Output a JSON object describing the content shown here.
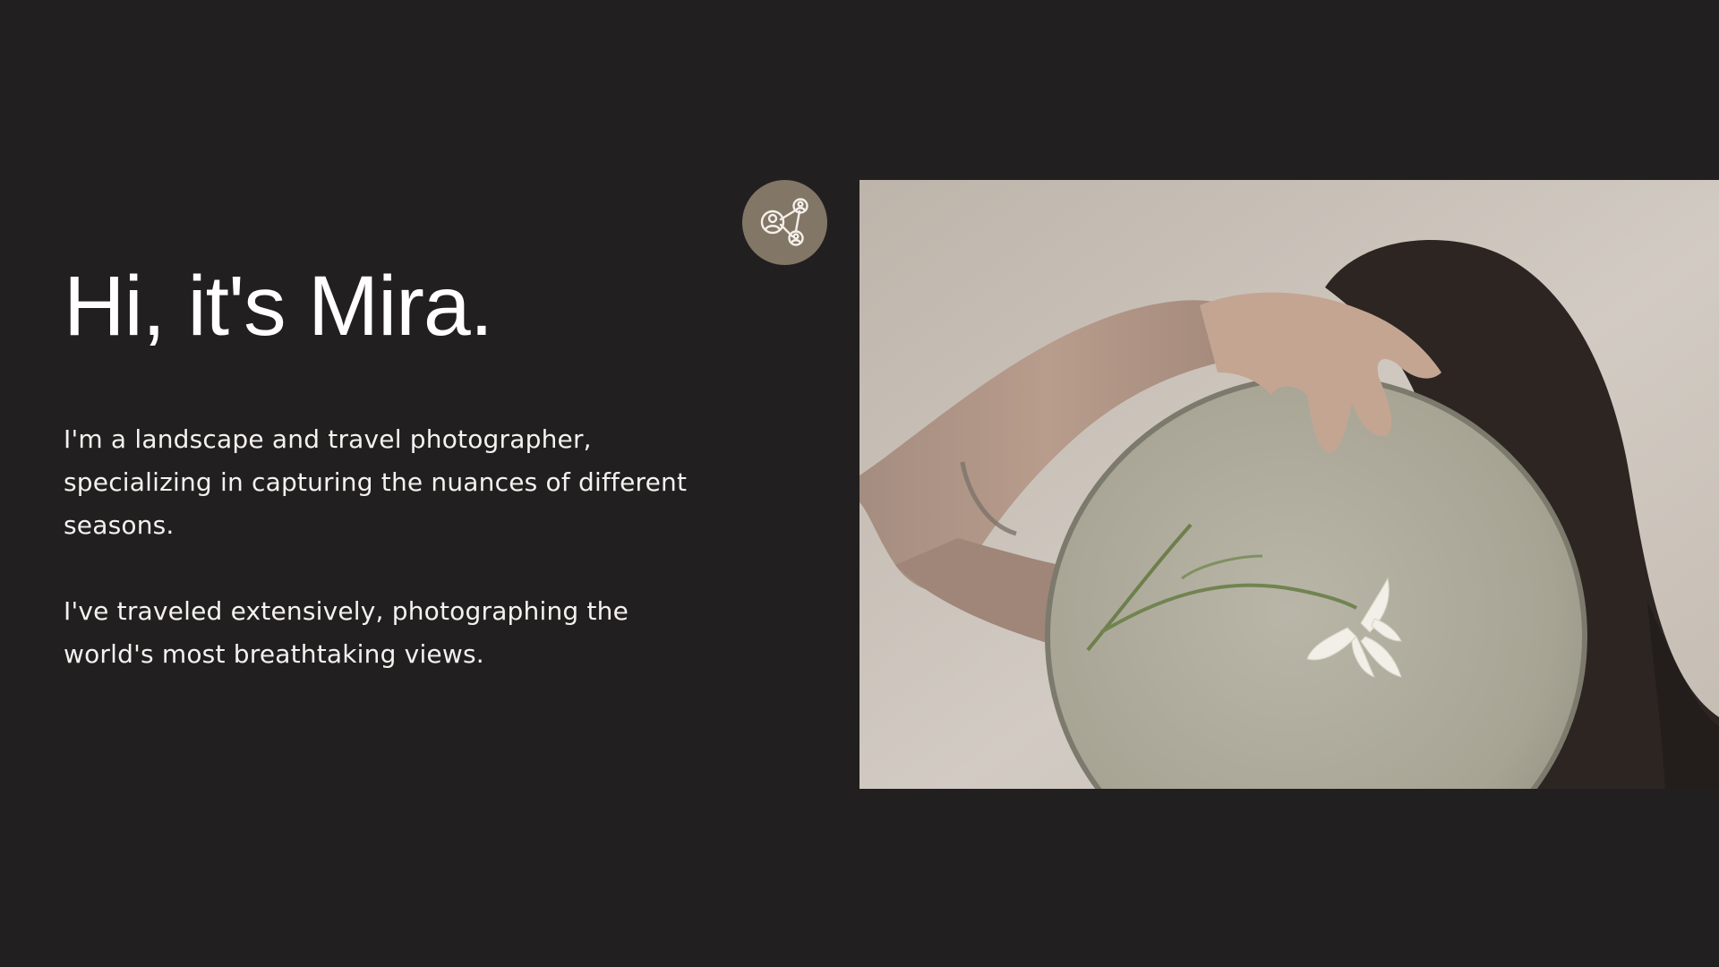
{
  "hero": {
    "headline": "Hi, it's Mira.",
    "paragraph_1": "I'm a landscape and travel photographer, specializing in capturing the nuances of different seasons.",
    "paragraph_2": "I've traveled extensively, photographing the world's most breathtaking views."
  },
  "badge": {
    "icon": "network-people-icon"
  },
  "colors": {
    "background": "#221f20",
    "text": "#ffffff",
    "badge": "#827666",
    "photo_wall": "#c9c1b7",
    "mirror": "#aeab9d"
  }
}
